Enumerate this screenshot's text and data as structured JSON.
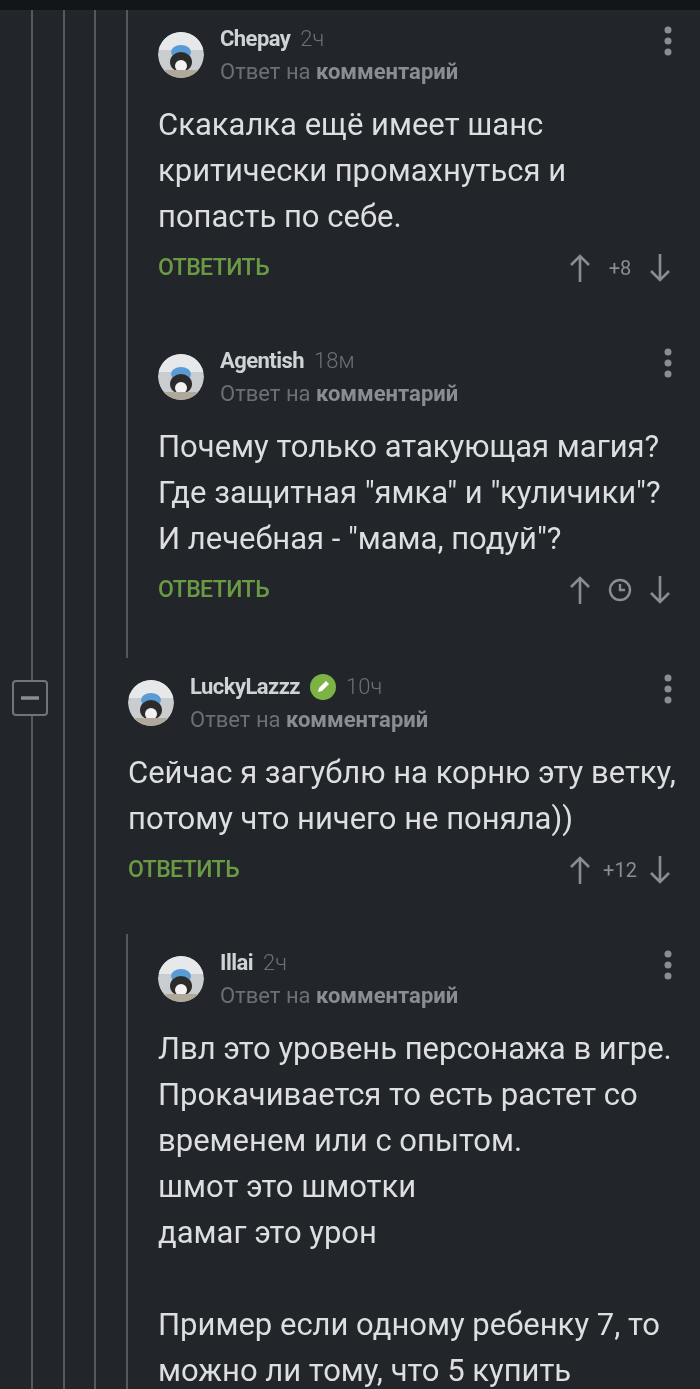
{
  "comments": [
    {
      "kind": "continuation",
      "children": [
        {
          "kind": "comment",
          "author": "Chepay",
          "time": "2ч",
          "reply_prefix": "Ответ на",
          "reply_target": "комментарий",
          "verified": false,
          "text": "Скакалка ещё имеет шанс критически промахнуться и попасть по себе.",
          "reply_label": "ОТВЕТИТЬ",
          "vote": {
            "kind": "score",
            "text": "+8"
          }
        },
        {
          "kind": "comment",
          "author": "Agentish",
          "time": "18м",
          "reply_prefix": "Ответ на",
          "reply_target": "комментарий",
          "verified": false,
          "text": "Почему только атакующая магия? Где защитная \"ямка\" и \"куличики\"? И лечебная - \"мама, подуй\"?",
          "reply_label": "ОТВЕТИТЬ",
          "vote": {
            "kind": "pending"
          }
        }
      ]
    },
    {
      "kind": "comment",
      "author": "LuckyLazzz",
      "time": "10ч",
      "reply_prefix": "Ответ на",
      "reply_target": "комментарий",
      "verified": true,
      "expanded": true,
      "text": "Сейчас я загублю на корню эту ветку, потому что ничего не поняла))",
      "reply_label": "ОТВЕТИТЬ",
      "vote": {
        "kind": "score",
        "text": "+12"
      },
      "children": [
        {
          "kind": "comment",
          "author": "Illai",
          "time": "2ч",
          "reply_prefix": "Ответ на",
          "reply_target": "комментарий",
          "verified": false,
          "text": "Лвл это уровень персонажа в игре. Прокачивается то есть растет со временем или с опытом.\nшмот это шмотки\nдамаг это урон\n\nПример если одному ребенку 7, то можно ли тому, что 5 купить"
        }
      ]
    }
  ]
}
